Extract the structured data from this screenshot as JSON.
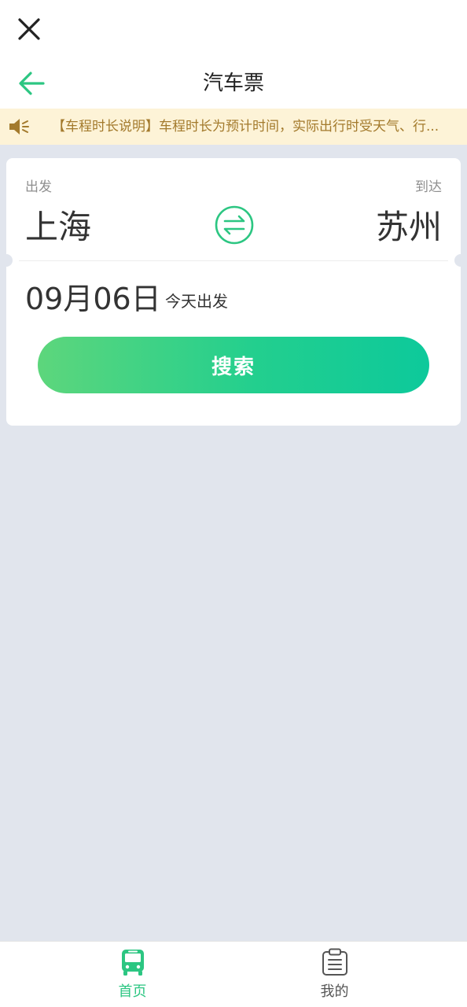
{
  "topbar": {
    "close_icon": "close-icon"
  },
  "header": {
    "title": "汽车票",
    "back_icon": "arrow-left-icon"
  },
  "notice": {
    "icon": "speaker-icon",
    "text": "【车程时长说明】车程时长为预计时间，实际出行时受天气、行..."
  },
  "search_card": {
    "depart_label": "出发",
    "arrive_label": "到达",
    "from_city": "上海",
    "to_city": "苏州",
    "swap_icon": "swap-icon",
    "date": "09月06日",
    "date_note": "今天出发",
    "search_label": "搜索"
  },
  "tabbar": {
    "items": [
      {
        "label": "首页",
        "icon": "bus-icon",
        "active": true
      },
      {
        "label": "我的",
        "icon": "clipboard-icon",
        "active": false
      }
    ]
  },
  "colors": {
    "accent": "#2cc682",
    "notice_bg": "#fdf3d7",
    "notice_text": "#a37a2c",
    "page_bg": "#e1e5ed"
  }
}
